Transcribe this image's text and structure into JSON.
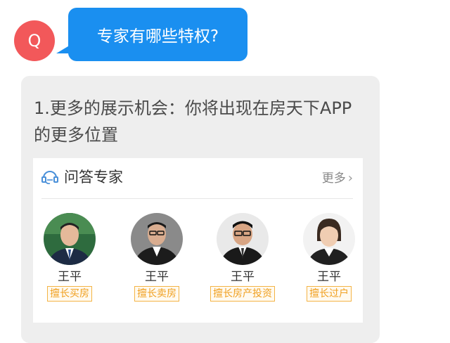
{
  "question": {
    "avatar_letter": "Q",
    "text": "专家有哪些特权?"
  },
  "answer": {
    "text": "1.更多的展示机会：你将出现在房天下APP的更多位置"
  },
  "panel": {
    "title": "问答专家",
    "more": "更多",
    "experts": [
      {
        "name": "王平",
        "tag": "擅长买房"
      },
      {
        "name": "王平",
        "tag": "擅长卖房"
      },
      {
        "name": "王平",
        "tag": "擅长房产投资"
      },
      {
        "name": "王平",
        "tag": "擅长过户"
      }
    ]
  },
  "colors": {
    "accent_blue": "#1a8ff0",
    "avatar_red": "#f2585a",
    "tag_orange": "#f0a020",
    "card_gray": "#eeeeee"
  }
}
